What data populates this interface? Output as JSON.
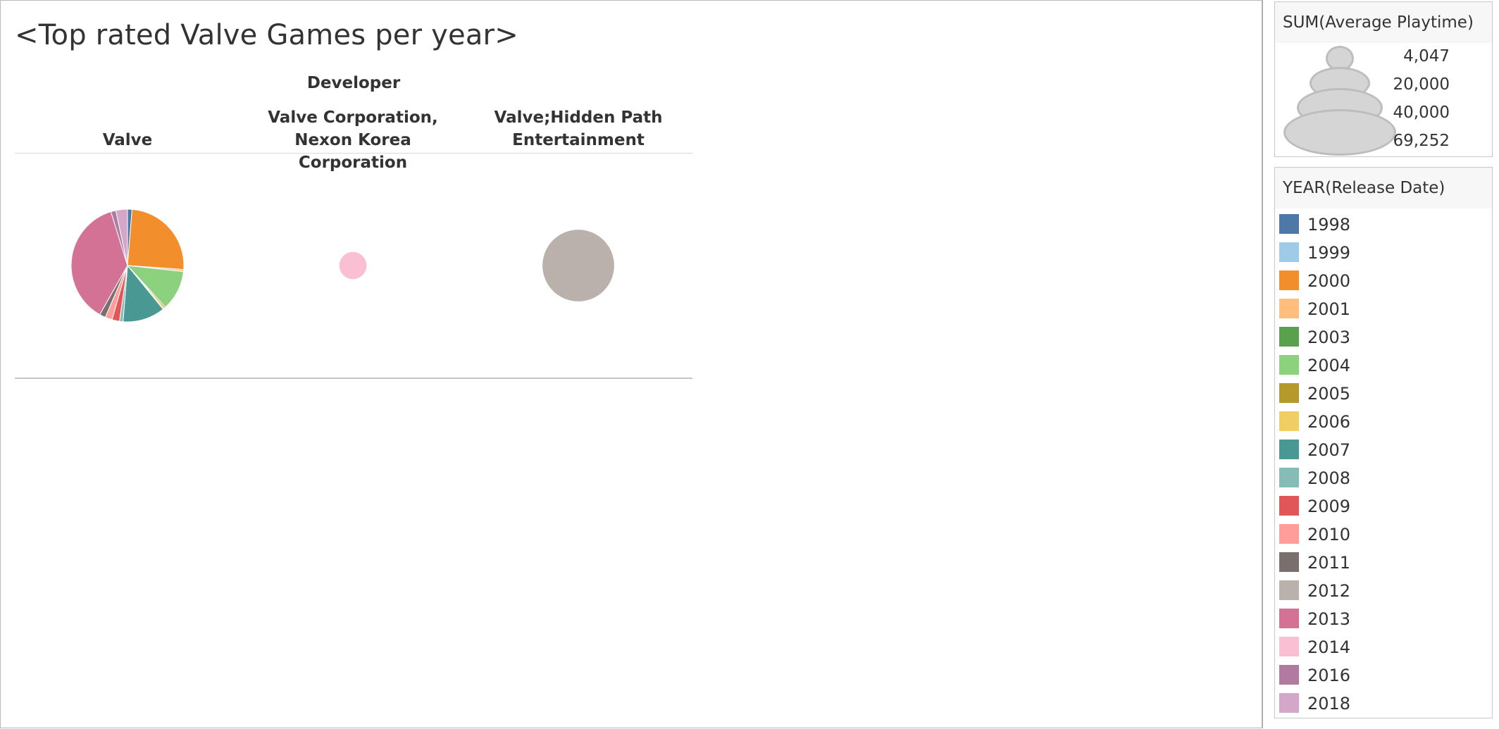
{
  "title": "<Top rated Valve Games per year>",
  "chart_data": {
    "type": "pie",
    "column_field": "Developer",
    "columns": [
      {
        "label": "Valve",
        "total": 69252,
        "slices": [
          {
            "year": "1998",
            "value": 900
          },
          {
            "year": "2000",
            "value": 17200
          },
          {
            "year": "2001",
            "value": 400
          },
          {
            "year": "2004",
            "value": 8000
          },
          {
            "year": "2005",
            "value": 300
          },
          {
            "year": "2006",
            "value": 300
          },
          {
            "year": "2007",
            "value": 8400
          },
          {
            "year": "2008",
            "value": 700
          },
          {
            "year": "2009",
            "value": 1500
          },
          {
            "year": "2010",
            "value": 1400
          },
          {
            "year": "2011",
            "value": 1200
          },
          {
            "year": "2013",
            "value": 25652
          },
          {
            "year": "2016",
            "value": 1000
          },
          {
            "year": "2018",
            "value": 2300
          }
        ]
      },
      {
        "label": "Valve Corporation, Nexon Korea Corporation",
        "total": 4047,
        "slices": [
          {
            "year": "2014",
            "value": 4047
          }
        ]
      },
      {
        "label": "Valve;Hidden Path Entertainment",
        "total": 28000,
        "slices": [
          {
            "year": "2012",
            "value": 28000
          }
        ]
      }
    ]
  },
  "size_legend": {
    "title": "SUM(Average Playtime)",
    "items": [
      {
        "value": 4047,
        "label": "4,047"
      },
      {
        "value": 20000,
        "label": "20,000"
      },
      {
        "value": 40000,
        "label": "40,000"
      },
      {
        "value": 69252,
        "label": "69,252"
      }
    ]
  },
  "color_legend": {
    "title": "YEAR(Release Date)",
    "items": [
      {
        "label": "1998",
        "color": "#4e79a7"
      },
      {
        "label": "1999",
        "color": "#a0cbe8"
      },
      {
        "label": "2000",
        "color": "#f28e2b"
      },
      {
        "label": "2001",
        "color": "#ffbe7d"
      },
      {
        "label": "2003",
        "color": "#59a14f"
      },
      {
        "label": "2004",
        "color": "#8cd17d"
      },
      {
        "label": "2005",
        "color": "#b6992d"
      },
      {
        "label": "2006",
        "color": "#f1ce63"
      },
      {
        "label": "2007",
        "color": "#499894"
      },
      {
        "label": "2008",
        "color": "#86bcb6"
      },
      {
        "label": "2009",
        "color": "#e15759"
      },
      {
        "label": "2010",
        "color": "#ff9d9a"
      },
      {
        "label": "2011",
        "color": "#79706e"
      },
      {
        "label": "2012",
        "color": "#bab0ac"
      },
      {
        "label": "2013",
        "color": "#d37295"
      },
      {
        "label": "2014",
        "color": "#fabfd2"
      },
      {
        "label": "2016",
        "color": "#b07aa1"
      },
      {
        "label": "2018",
        "color": "#d4a6c8"
      }
    ]
  }
}
